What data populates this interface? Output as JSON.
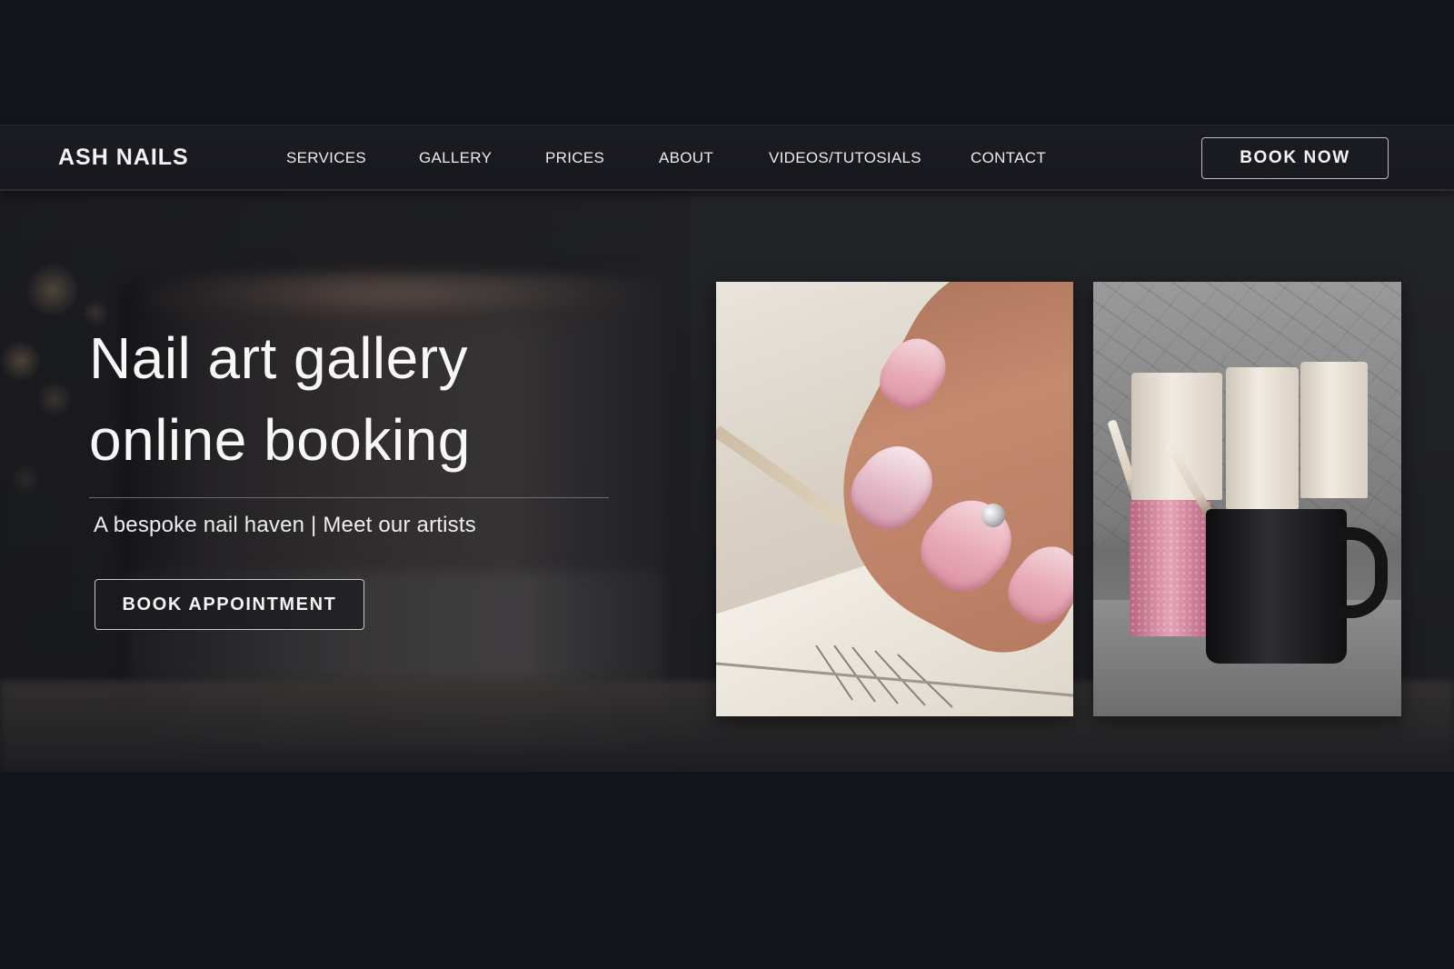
{
  "nav": {
    "brand": "ASH NAILS",
    "links": [
      "SERVICES",
      "GALLERY",
      "PRICES",
      "ABOUT",
      "VIDEOS/TUTOSIALS",
      "CONTACT"
    ],
    "cta": "BOOK NOW"
  },
  "hero": {
    "title_line1": "Nail art gallery",
    "title_line2": "online booking",
    "subtitle": "A bespoke nail haven | Meet our artists",
    "cta": "BOOK APPOINTMENT"
  },
  "colors": {
    "background": "#14151b",
    "navbar": "#1b1c22",
    "text": "#f2f2f2",
    "button_border": "#bdbdbd",
    "nail_pink": "#e7a9b6"
  },
  "icons": {
    "photo_left": "manicured-nails-photo",
    "photo_right": "nail-polish-bottles-photo"
  }
}
